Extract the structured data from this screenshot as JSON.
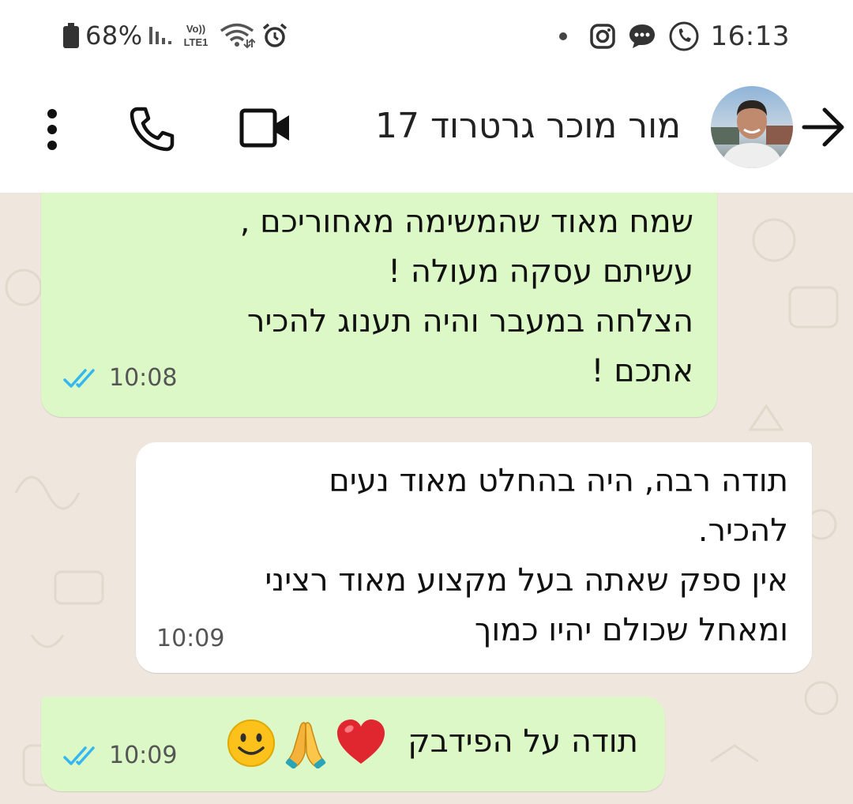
{
  "status_bar": {
    "battery": "68%",
    "time": "16:13",
    "left_icons": [
      "battery-icon",
      "signal-icon",
      "volte-icon",
      "wifi-icon",
      "alarm-icon"
    ],
    "volte_label_top": "Vo))",
    "volte_label_bottom": "LTE1",
    "right_icons": [
      "notification-dot-icon",
      "instagram-icon",
      "chat-bubble-icon",
      "phone-call-icon"
    ]
  },
  "header": {
    "contact_name": "מור מוכר גרטרוד 17",
    "icons": [
      "back-arrow-icon",
      "avatar",
      "video-call-icon",
      "voice-call-icon",
      "more-vert-icon"
    ]
  },
  "messages": [
    {
      "direction": "outgoing",
      "lines": [
        "שמח מאוד שהמשימה מאחוריכם ,",
        "עשיתם עסקה מעולה !",
        "הצלחה במעבר והיה תענוג להכיר",
        "אתכם !"
      ],
      "time": "10:08",
      "status": "read"
    },
    {
      "direction": "incoming",
      "lines": [
        "תודה רבה, היה בהחלט מאוד נעים",
        "להכיר.",
        "אין ספק שאתה בעל מקצוע מאוד רציני",
        "ומאחל שכולם יהיו כמוך"
      ],
      "time": "10:09"
    },
    {
      "direction": "outgoing",
      "lines": [
        "תודה על הפידבק"
      ],
      "emojis": [
        "red-heart-icon",
        "folded-hands-icon",
        "smiling-face-icon"
      ],
      "time": "10:09",
      "status": "read"
    }
  ],
  "colors": {
    "outgoing_bubble": "#dcf8c6",
    "incoming_bubble": "#ffffff",
    "chat_background": "#efe7de",
    "read_ticks": "#34b7f1"
  }
}
